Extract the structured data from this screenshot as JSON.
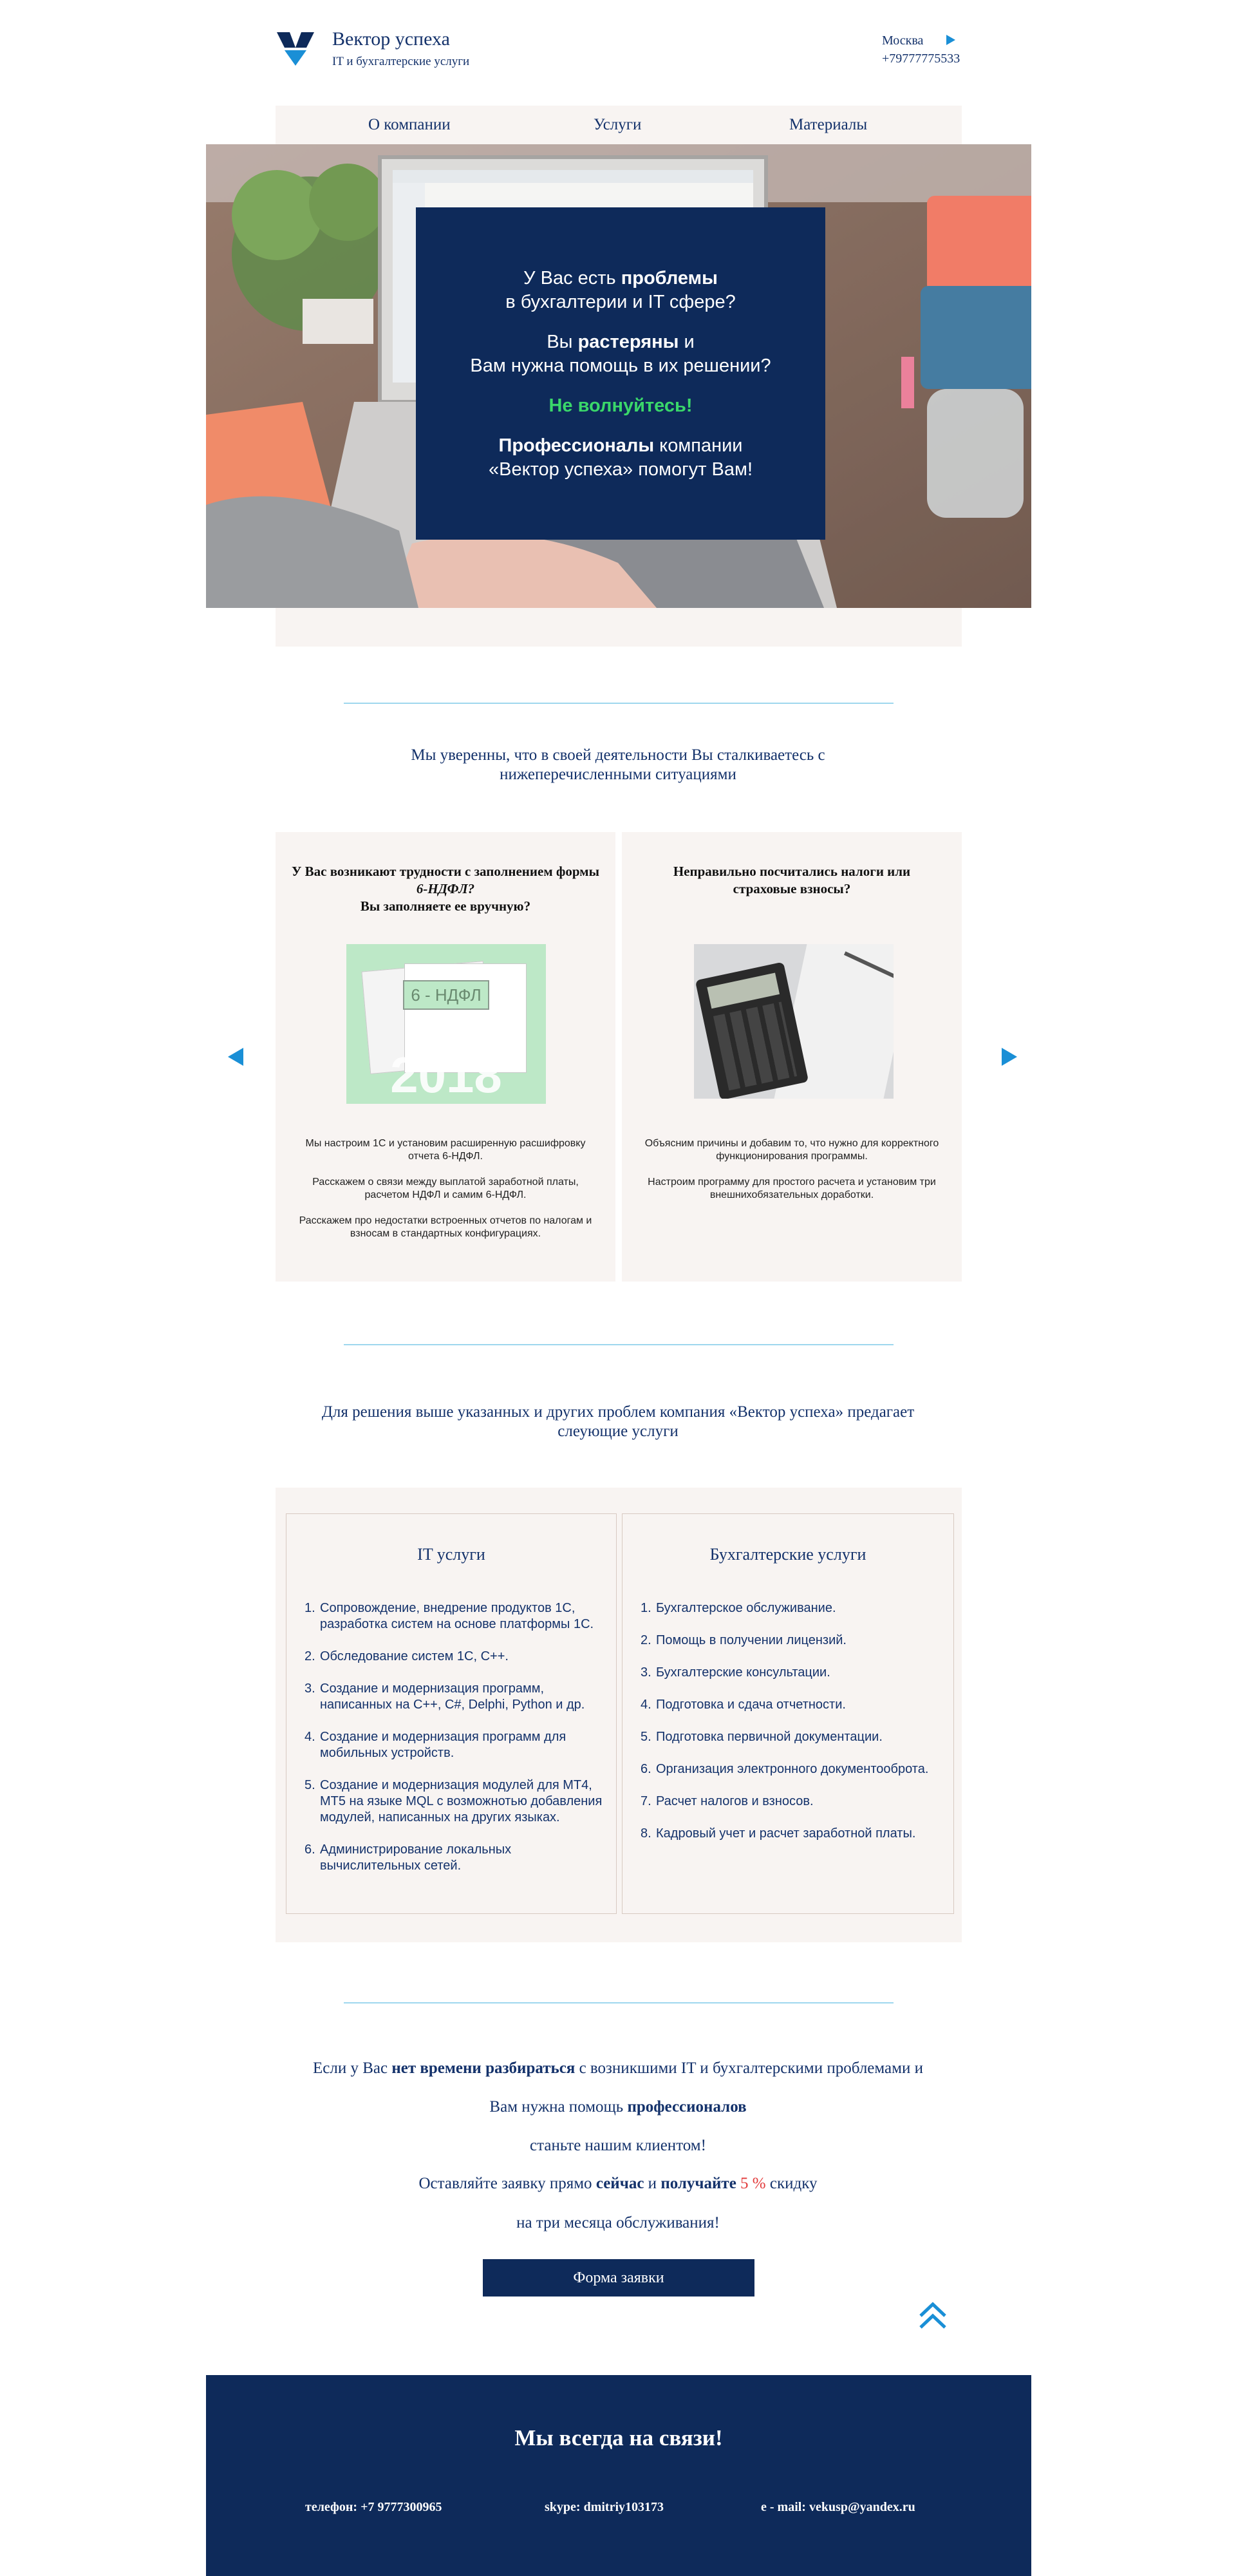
{
  "header": {
    "company_name": "Вектор успеха",
    "tagline": "IT и бухгалтерские услуги",
    "city": "Москва",
    "phone": "+79777775533"
  },
  "nav": {
    "items": [
      {
        "label": "О компании"
      },
      {
        "label": "Услуги"
      },
      {
        "label": "Материалы"
      }
    ]
  },
  "hero": {
    "l1a": "У Вас есть ",
    "l1b": "проблемы",
    "l2": "в бухгалтерии и IT сфере?",
    "l3a": "Вы ",
    "l3b": "растеряны",
    "l3c": " и",
    "l4": "Вам нужна помощь в их решении?",
    "l5": "Не волнуйтесь!",
    "l6a": "Профессионалы",
    "l6b": " компании",
    "l7": "«Вектор успеха» помогут Вам!"
  },
  "situations": {
    "title": "Мы уверенны, что в своей деятельности Вы сталкиваетесь с нижеперечисленными ситуациями",
    "cards": [
      {
        "head1": "У Вас возникают трудности с заполнением формы ",
        "head_italic": "6-НДФЛ?",
        "head2": "Вы заполняете ее вручную?",
        "image_badge": "6 - НДФЛ",
        "image_year": "2018",
        "p1": "Мы настроим 1С и установим расширенную расшифровку отчета 6-НДФЛ.",
        "p2": "Расскажем о связи между выплатой заработной платы, расчетом НДФЛ и самим 6-НДФЛ.",
        "p3": "Расскажем про недостатки встроенных отчетов по налогам и взносам в стандартных конфигурациях."
      },
      {
        "head1": "Неправильно посчитались налоги или страховые взносы?",
        "p1": "Объясним причины и добавим то, что нужно для корректного функционирования программы.",
        "p2": "Настроим программу для простого расчета и установим три внешнихобязательных доработки."
      }
    ]
  },
  "services": {
    "title": "Для решения выше указанных и других проблем компания «Вектор успеха» предагает слеующие услуги",
    "it": {
      "title": "IT услуги",
      "items": [
        "Сопровождение, внедрение продуктов 1С, разработка систем на основе платформы 1С.",
        "Обследование систем 1С, С++.",
        "Создание и модернизация программ, написанных на С++, С#, Delphi, Python и др.",
        "Создание и модернизация программ для мобильных устройств.",
        "Создание и модернизация модулей для МТ4, МТ5  на языке MQL с возможнотью добавления модулей, написанных на других языках.",
        "Администрирование локальных вычислительных сетей."
      ]
    },
    "acc": {
      "title": "Бухгалтерские услуги",
      "items": [
        "Бухгалтерское обслуживание.",
        "Помощь в получении лицензий.",
        "Бухгалтерские консультации.",
        "Подготовка и сдача отчетности.",
        "Подготовка первичной документации.",
        "Организация электронного документооброта.",
        "Расчет налогов и взносов.",
        "Кадровый учет и расчет заработной платы."
      ]
    }
  },
  "cta": {
    "l1a": "Если у Вас ",
    "l1b": "нет времени разбираться",
    "l1c": " с возникшими IT и бухгалтерскими проблемами и",
    "l2a": "Вам нужна помощь ",
    "l2b": "профессионалов",
    "l3": "станьте нашим клиентом!",
    "l4a": "Оставляйте заявку прямо ",
    "l4b": "сейчас",
    "l4c": " и ",
    "l4d": "получайте",
    "l4e": " 5 %",
    "l4f": " скидку",
    "l5": "на три месяца обслуживания!",
    "button": "Форма заявки"
  },
  "footer": {
    "title": "Мы всегда на связи!",
    "phone": "телефон: +7 9777300965",
    "skype": "skype: dmitriy103173",
    "email": "e - mail: vekusp@yandex.ru"
  },
  "colors": {
    "navy": "#0e2a5a",
    "accent_blue": "#1a8fd6",
    "green": "#3ad76a",
    "red": "#e23a3a",
    "panel": "#f8f4f2"
  }
}
